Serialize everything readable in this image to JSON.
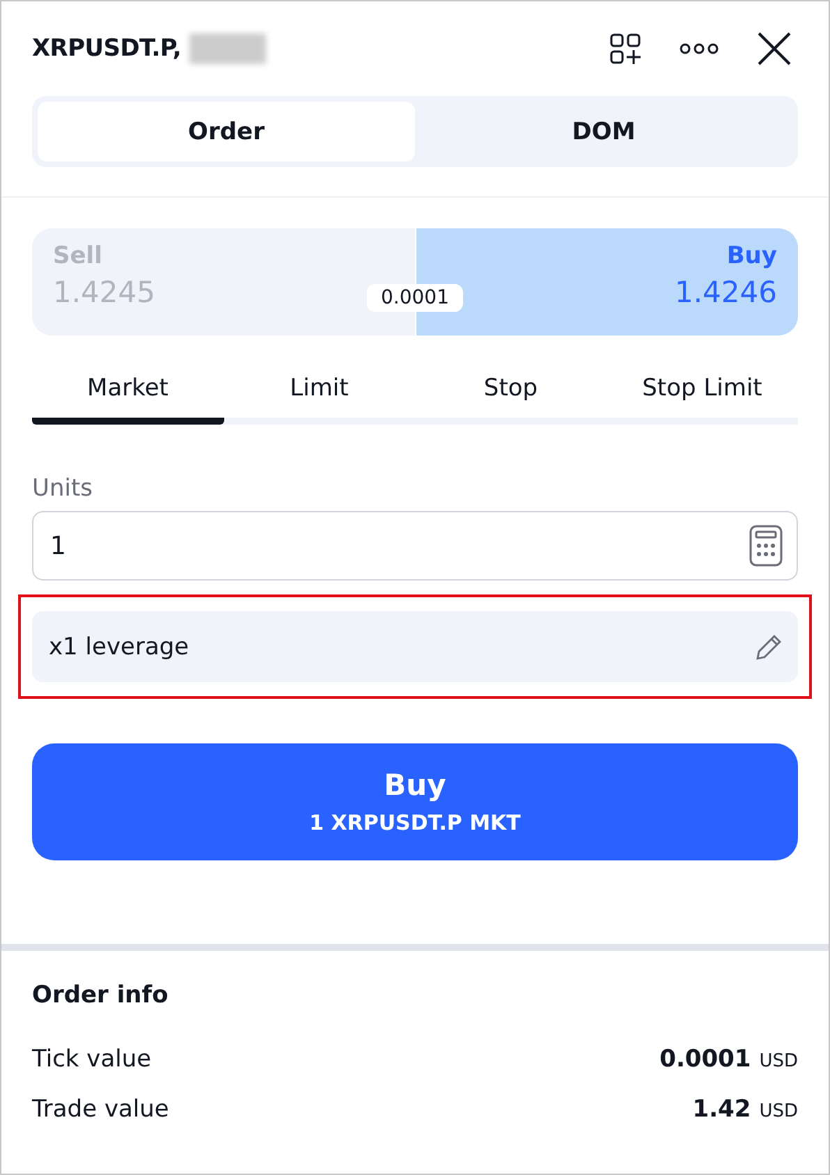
{
  "header": {
    "title": "XRPUSDT.P,"
  },
  "tabs": [
    {
      "label": "Order",
      "selected": true
    },
    {
      "label": "DOM",
      "selected": false
    }
  ],
  "quote": {
    "sides": [
      {
        "label": "Sell",
        "price": "1.4245",
        "selected": false
      },
      {
        "label": "Buy",
        "price": "1.4246",
        "selected": true
      }
    ],
    "spread": "0.0001"
  },
  "order_types": [
    {
      "label": "Market",
      "selected": true
    },
    {
      "label": "Limit",
      "selected": false
    },
    {
      "label": "Stop",
      "selected": false
    },
    {
      "label": "Stop Limit",
      "selected": false
    }
  ],
  "units": {
    "label": "Units",
    "value": "1"
  },
  "leverage": {
    "label": "x1 leverage",
    "highlighted": true
  },
  "submit": {
    "label": "Buy",
    "detail": "1 XRPUSDT.P MKT"
  },
  "order_info": {
    "title": "Order info",
    "rows": [
      {
        "label": "Tick value",
        "value": "0.0001",
        "unit": "USD"
      },
      {
        "label": "Trade value",
        "value": "1.42",
        "unit": "USD"
      }
    ]
  }
}
